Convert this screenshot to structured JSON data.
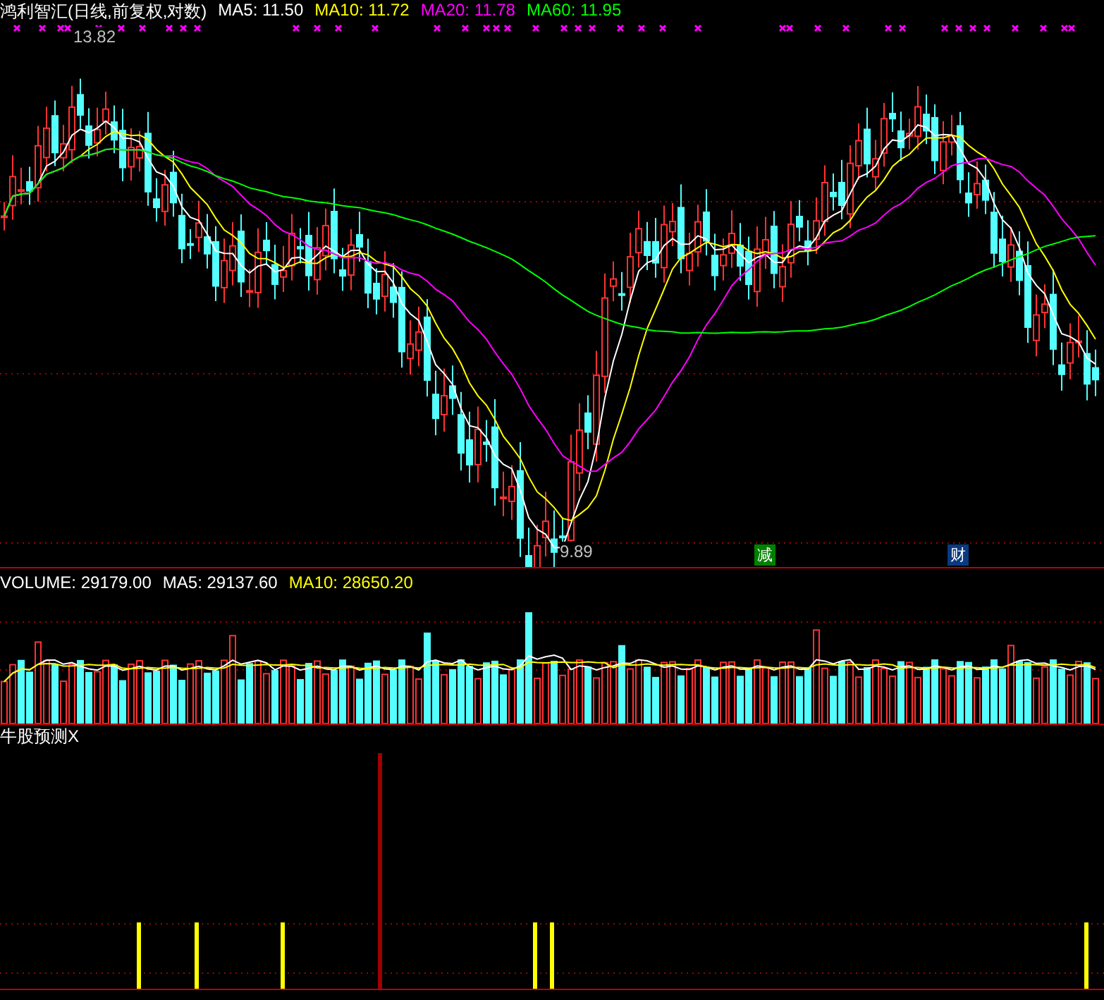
{
  "main_panel": {
    "title": "鸿利智汇(日线,前复权,对数)",
    "indicators": [
      {
        "label": "MA5: 11.50",
        "color": "#ffffff"
      },
      {
        "label": "MA10: 11.72",
        "color": "#ffff00"
      },
      {
        "label": "MA20: 11.78",
        "color": "#ff00ff"
      },
      {
        "label": "MA60: 11.95",
        "color": "#00ff00"
      }
    ],
    "high_label": "13.82",
    "low_label": "9.89",
    "event_badges": [
      {
        "label": "减",
        "color": "#008000"
      },
      {
        "label": "财",
        "color": "#0a3a80"
      }
    ]
  },
  "volume_panel": {
    "indicators": [
      {
        "label": "VOLUME: 29179.00",
        "color": "#ffffff"
      },
      {
        "label": "MA5: 29137.60",
        "color": "#ffffff"
      },
      {
        "label": "MA10: 28650.20",
        "color": "#ffff00"
      }
    ]
  },
  "signal_panel": {
    "title": "牛股预测X"
  }
}
